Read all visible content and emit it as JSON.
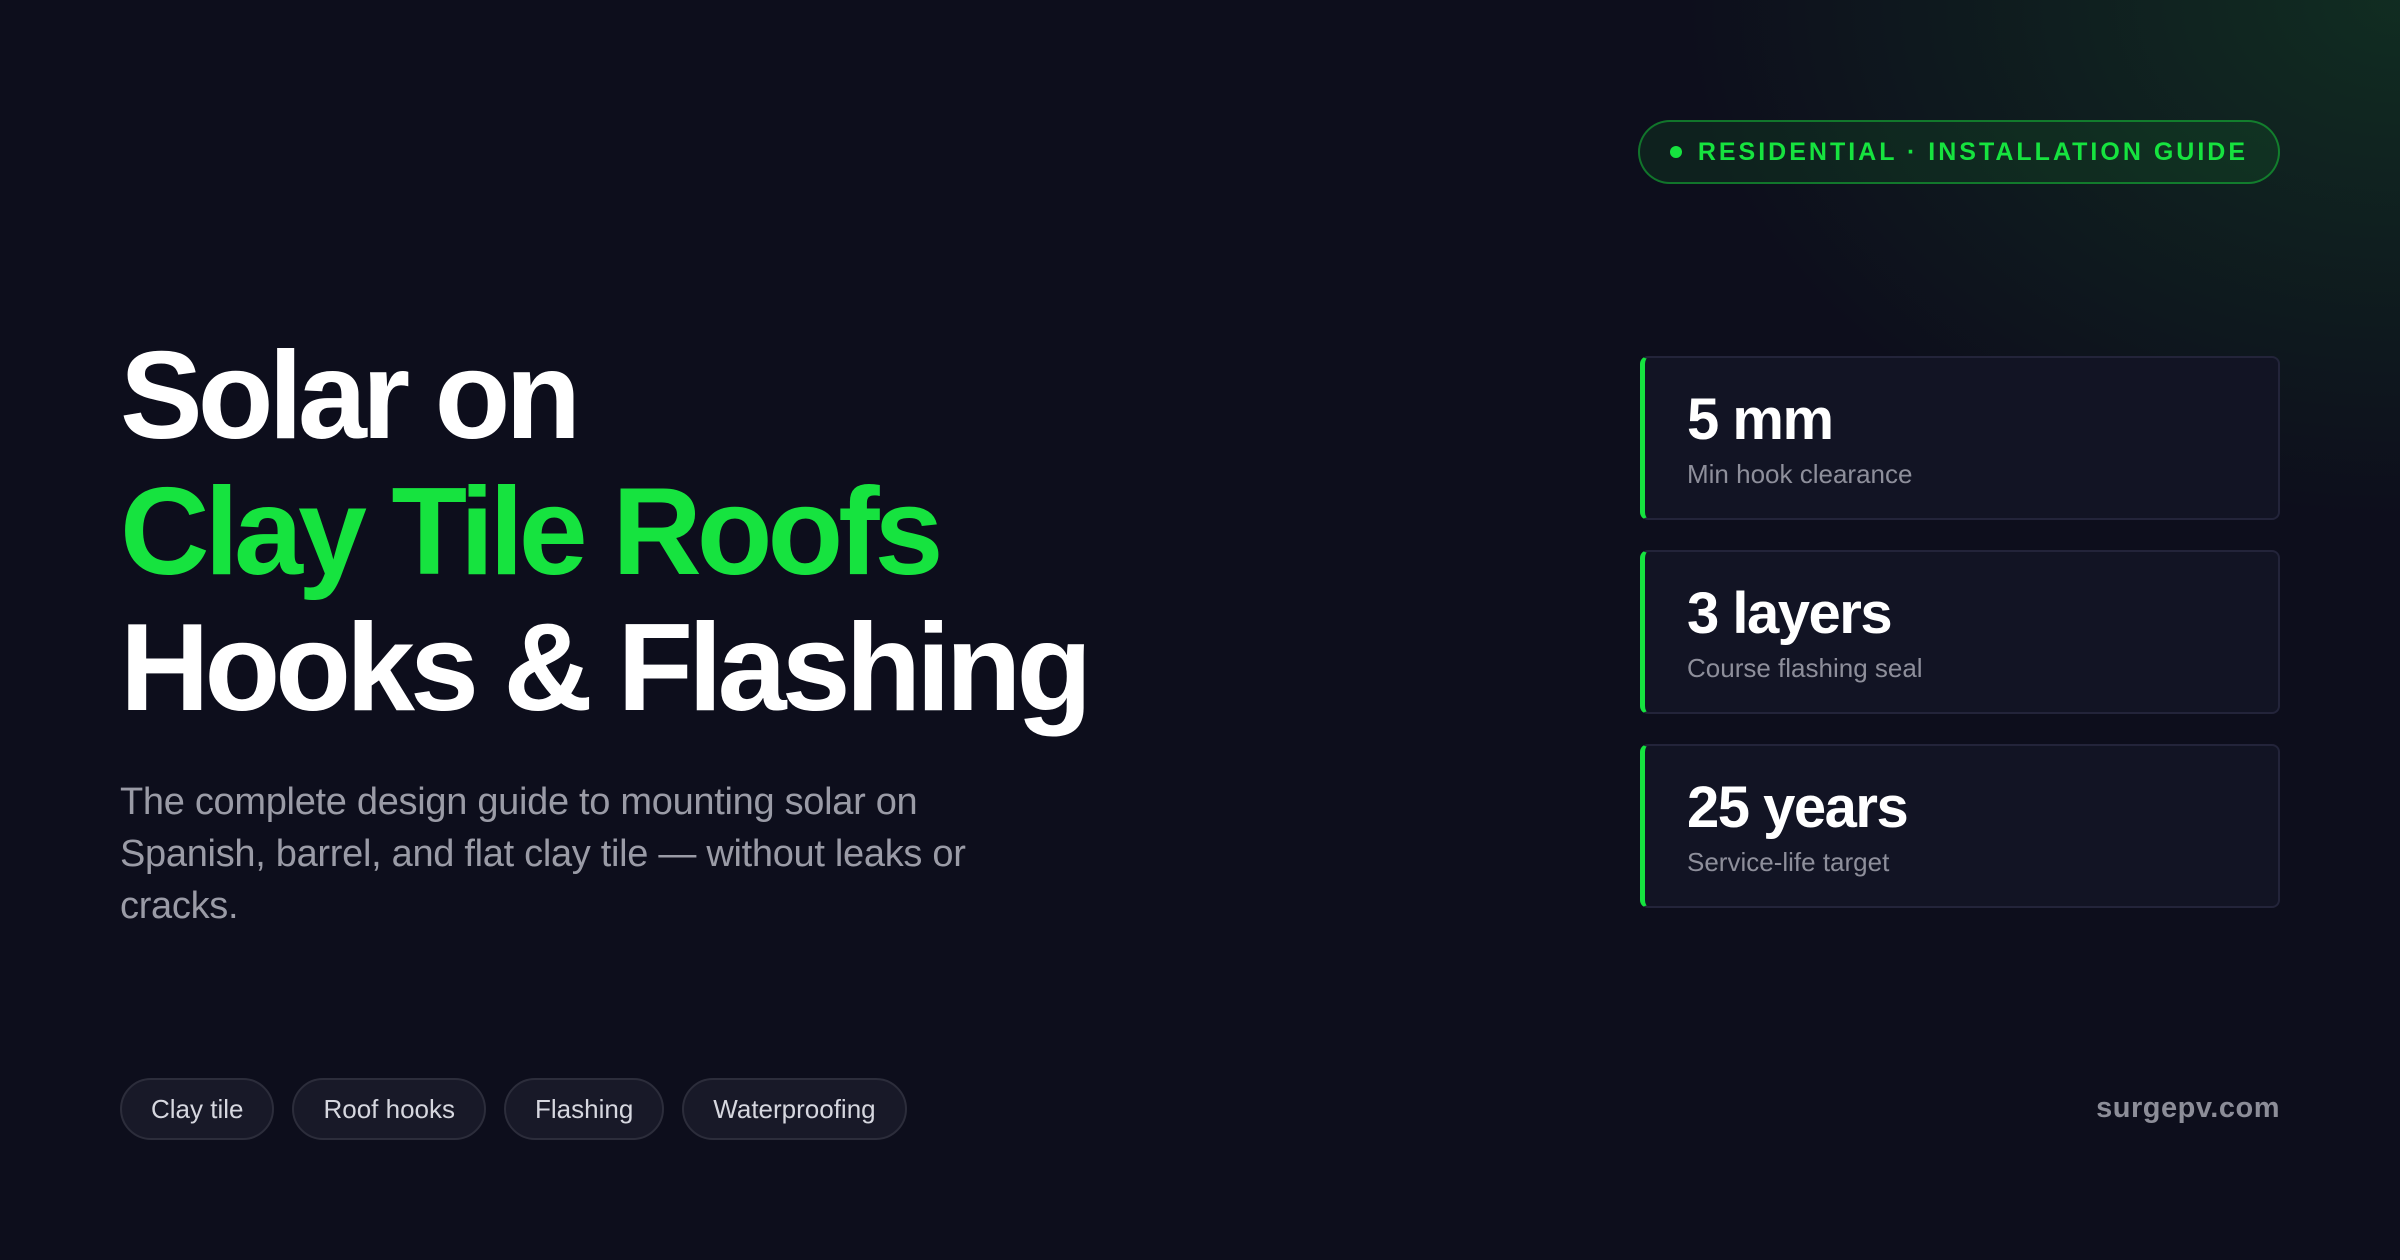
{
  "badge": {
    "text": "RESIDENTIAL · INSTALLATION GUIDE"
  },
  "headline": {
    "line1": "Solar on",
    "line2": "Clay Tile Roofs",
    "line3": "Hooks & Flashing"
  },
  "subtitle": "The complete design guide to mounting solar on Spanish, barrel, and flat clay tile — without leaks or cracks.",
  "stats": [
    {
      "value": "5 mm",
      "label": "Min hook clearance"
    },
    {
      "value": "3 layers",
      "label": "Course flashing seal"
    },
    {
      "value": "25 years",
      "label": "Service-life target"
    }
  ],
  "tags": [
    "Clay tile",
    "Roof hooks",
    "Flashing",
    "Waterproofing"
  ],
  "footer": {
    "domain": "surgepv.com"
  },
  "colors": {
    "background": "#0d0e1c",
    "accent": "#16e33f",
    "text_primary": "#ffffff",
    "text_muted": "#9a9ba6"
  }
}
